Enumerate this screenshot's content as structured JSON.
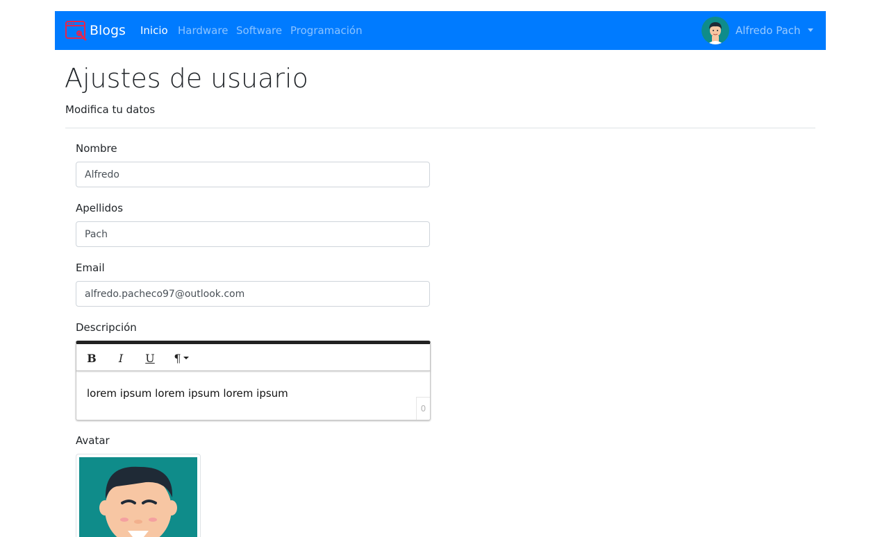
{
  "navbar": {
    "brand": "Blogs",
    "links": [
      {
        "label": "Inicio",
        "active": true
      },
      {
        "label": "Hardware",
        "active": false
      },
      {
        "label": "Software",
        "active": false
      },
      {
        "label": "Programación",
        "active": false
      }
    ],
    "user_name": "Alfredo Pach",
    "bg_color": "#007bff"
  },
  "page": {
    "title": "Ajustes de usuario",
    "subtitle": "Modifica tu datos"
  },
  "form": {
    "nombre_label": "Nombre",
    "nombre_value": "Alfredo",
    "apellidos_label": "Apellidos",
    "apellidos_value": "Pach",
    "email_label": "Email",
    "email_value": "alfredo.pacheco97@outlook.com",
    "descripcion_label": "Descripción",
    "descripcion_text": "lorem ipsum lorem ipsum lorem ipsum",
    "char_count": "0",
    "toolbar": {
      "bold": "B",
      "italic": "I",
      "underline": "U",
      "paragraph": "¶"
    },
    "avatar_label": "Avatar"
  },
  "icons": [
    "window-logo-icon",
    "bold-icon",
    "italic-icon",
    "underline-icon",
    "paragraph-icon",
    "user-avatar"
  ]
}
